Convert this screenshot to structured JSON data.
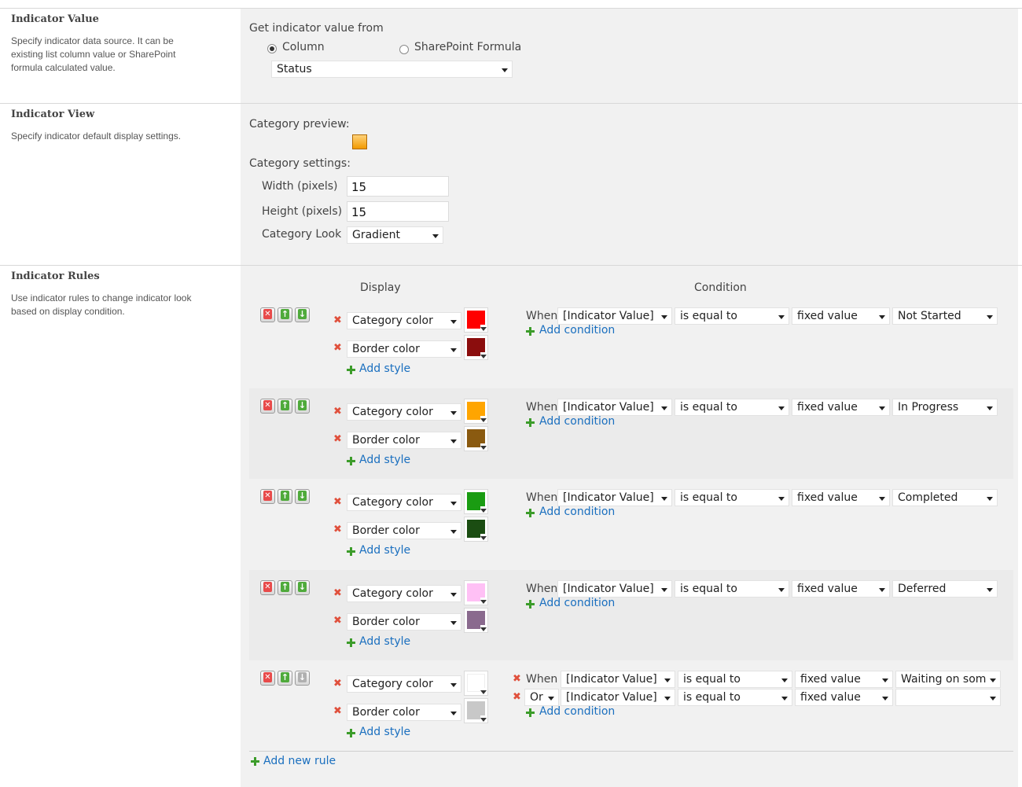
{
  "indicator_value": {
    "title": "Indicator Value",
    "description": "Specify indicator data source. It can be existing list column value or SharePoint formula calculated value.",
    "get_from_label": "Get indicator value from",
    "radio_column": "Column",
    "radio_formula": "SharePoint Formula",
    "selected_source": "Column",
    "column_select": "Status"
  },
  "indicator_view": {
    "title": "Indicator View",
    "description": "Specify indicator default display settings.",
    "preview_label": "Category preview:",
    "settings_label": "Category settings:",
    "width_label": "Width (pixels)",
    "width_value": "15",
    "height_label": "Height (pixels)",
    "height_value": "15",
    "look_label": "Category Look",
    "look_value": "Gradient"
  },
  "indicator_rules": {
    "title": "Indicator Rules",
    "description": "Use indicator rules to change indicator look based on display condition.",
    "display_header": "Display",
    "condition_header": "Condition",
    "add_style": "Add style",
    "add_condition": "Add condition",
    "add_new_rule": "Add new rule",
    "category_color_label": "Category color",
    "border_color_label": "Border color",
    "rules": [
      {
        "category_color": "#ff0000",
        "border_color": "#8b0d0d",
        "conditions": [
          {
            "connector": "When",
            "field": "[Indicator Value]",
            "operator": "is equal to",
            "type": "fixed value",
            "value": "Not Started"
          }
        ]
      },
      {
        "category_color": "#ffa500",
        "border_color": "#8a5a10",
        "conditions": [
          {
            "connector": "When",
            "field": "[Indicator Value]",
            "operator": "is equal to",
            "type": "fixed value",
            "value": "In Progress"
          }
        ]
      },
      {
        "category_color": "#1a9c12",
        "border_color": "#1b4d12",
        "conditions": [
          {
            "connector": "When",
            "field": "[Indicator Value]",
            "operator": "is equal to",
            "type": "fixed value",
            "value": "Completed"
          }
        ]
      },
      {
        "category_color": "#ffc0f5",
        "border_color": "#8a6a8e",
        "conditions": [
          {
            "connector": "When",
            "field": "[Indicator Value]",
            "operator": "is equal to",
            "type": "fixed value",
            "value": "Deferred"
          }
        ]
      },
      {
        "category_color": "#ffffff",
        "border_color": "#c8c8c8",
        "conditions": [
          {
            "connector": "When",
            "field": "[Indicator Value]",
            "operator": "is equal to",
            "type": "fixed value",
            "value": "Waiting on som"
          },
          {
            "connector": "Or",
            "field": "[Indicator Value]",
            "operator": "is equal to",
            "type": "fixed value",
            "value": ""
          }
        ]
      }
    ]
  }
}
